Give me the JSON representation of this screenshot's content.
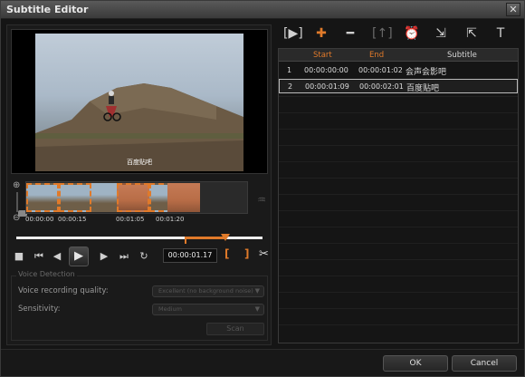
{
  "window": {
    "title": "Subtitle Editor",
    "close_glyph": "✕"
  },
  "preview": {
    "overlay_subtitle": "百度贴吧"
  },
  "timeline": {
    "timecodes": [
      "00:00:00",
      "00:00:15",
      "00:01:05",
      "00:01:20"
    ]
  },
  "transport": {
    "timecode": "00:00:01.17",
    "mark_in": "[",
    "mark_out": "]"
  },
  "voice_detection": {
    "group_label": "Voice Detection",
    "quality_label": "Voice recording quality:",
    "quality_value": "Excellent (no background noise)",
    "sensitivity_label": "Sensitivity:",
    "sensitivity_value": "Medium",
    "scan_label": "Scan"
  },
  "toolbar": {
    "icons": [
      "play-subtitle-icon",
      "add-icon",
      "remove-icon",
      "join-icon",
      "time-offset-icon",
      "import-icon",
      "export-icon",
      "text-options-icon"
    ]
  },
  "table": {
    "headers": {
      "start": "Start",
      "end": "End",
      "subtitle": "Subtitle"
    },
    "rows": [
      {
        "idx": "1",
        "start": "00:00:00:00",
        "end": "00:00:01:02",
        "subtitle": "会声会影吧"
      },
      {
        "idx": "2",
        "start": "00:00:01:09",
        "end": "00:00:02:01",
        "subtitle": "百度贴吧"
      }
    ]
  },
  "footer": {
    "ok_label": "OK",
    "cancel_label": "Cancel"
  },
  "colors": {
    "accent": "#e07a2a",
    "background": "#151515"
  }
}
